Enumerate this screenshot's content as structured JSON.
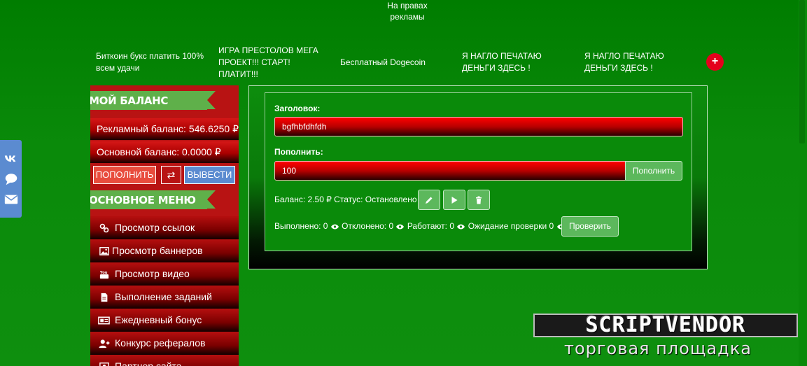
{
  "ads": {
    "top_banner": "На правах\nрекламы",
    "links": [
      "Биткоин букс платить 100%\nвсем удачи",
      "ИГРА ПРЕСТОЛОВ МЕГА\nПРОЕКТ!!! СТАРТ!\nПЛАТИТ!!!",
      "Бесплатный Dogecoin",
      "Я НАГЛО ПЕЧАТАЮ\nДЕНЬГИ ЗДЕСЬ !",
      "Я НАГЛО ПЕЧАТАЮ\nДЕНЬГИ ЗДЕСЬ !"
    ],
    "add_button": "+"
  },
  "social": {
    "icons": [
      "vk-icon",
      "chat-icon",
      "mail-icon"
    ]
  },
  "sidebar": {
    "balance_title": "МОЙ БАЛАНС",
    "ad_balance": "Рекламный баланс: 546.6250 ₽",
    "main_balance": "Основной баланс: 0.0000 ₽",
    "topup_button": "ПОПОЛНИТЬ",
    "exchange_icon": "⇄",
    "withdraw_button": "ВЫВЕСТИ",
    "menu_title": "ОСНОВНОЕ МЕНЮ",
    "menu_items": [
      {
        "label": "Просмотр ссылок",
        "icon": "link-icon"
      },
      {
        "label": "Просмотр баннеров",
        "icon": "image-icon"
      },
      {
        "label": "Просмотр видео",
        "icon": "youtube-icon"
      },
      {
        "label": "Выполнение заданий",
        "icon": "file-icon"
      },
      {
        "label": "Ежедневный бонус",
        "icon": "ticket-icon"
      },
      {
        "label": "Конкурс рефералов",
        "icon": "user-plus-icon"
      },
      {
        "label": "Партнер сайта",
        "icon": "partner-icon"
      }
    ]
  },
  "form": {
    "title_label": "Заголовок:",
    "title_value": "bgfhbfdhfdh",
    "topup_label": "Пополнить:",
    "topup_value": "100",
    "topup_button": "Пополнить",
    "status_text": "Баланс: 2.50 ₽ Статус: Остановлено",
    "stats": {
      "done": "Выполнено: 0",
      "rejected": "Отклонено: 0",
      "working": "Работают: 0",
      "pending": "Ожидание проверки 0"
    },
    "check_button": "Проверить"
  },
  "watermark": {
    "brand": "SCRIPTVENDOR",
    "subtitle": "торговая площадка"
  },
  "colors": {
    "background": "#0a8a0a",
    "sidebar": "#b81313",
    "ribbon": "#5fb04a",
    "accent_blue": "#5b8bd0",
    "button_green": "#5cb85c"
  }
}
